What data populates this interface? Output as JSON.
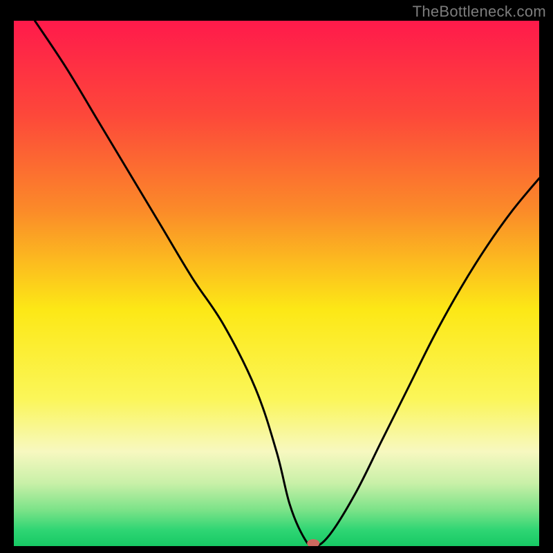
{
  "watermark": "TheBottleneck.com",
  "chart_data": {
    "type": "line",
    "title": "",
    "xlabel": "",
    "ylabel": "",
    "xlim": [
      0,
      100
    ],
    "ylim": [
      0,
      100
    ],
    "background_gradient": {
      "stops": [
        {
          "offset": 0.0,
          "color": "#ff1a4b"
        },
        {
          "offset": 0.18,
          "color": "#fd483a"
        },
        {
          "offset": 0.36,
          "color": "#fb8a29"
        },
        {
          "offset": 0.55,
          "color": "#fce816"
        },
        {
          "offset": 0.72,
          "color": "#fbf659"
        },
        {
          "offset": 0.82,
          "color": "#f7f8c0"
        },
        {
          "offset": 0.88,
          "color": "#c9f0a8"
        },
        {
          "offset": 0.93,
          "color": "#7ee389"
        },
        {
          "offset": 0.97,
          "color": "#2ed573"
        },
        {
          "offset": 1.0,
          "color": "#17c964"
        }
      ]
    },
    "series": [
      {
        "name": "bottleneck-curve",
        "x": [
          4,
          10,
          16,
          22,
          28,
          34,
          40,
          46,
          50,
          52.5,
          55,
          57,
          60,
          65,
          70,
          75,
          80,
          85,
          90,
          95,
          100
        ],
        "y": [
          100,
          91,
          81,
          71,
          61,
          51,
          42,
          30,
          18,
          8,
          2,
          0,
          2,
          10,
          20,
          30,
          40,
          49,
          57,
          64,
          70
        ]
      }
    ],
    "marker": {
      "x": 57,
      "y": 0,
      "rx": 9,
      "ry": 6,
      "color": "#cc6a5f"
    },
    "curve_color": "#000000"
  }
}
